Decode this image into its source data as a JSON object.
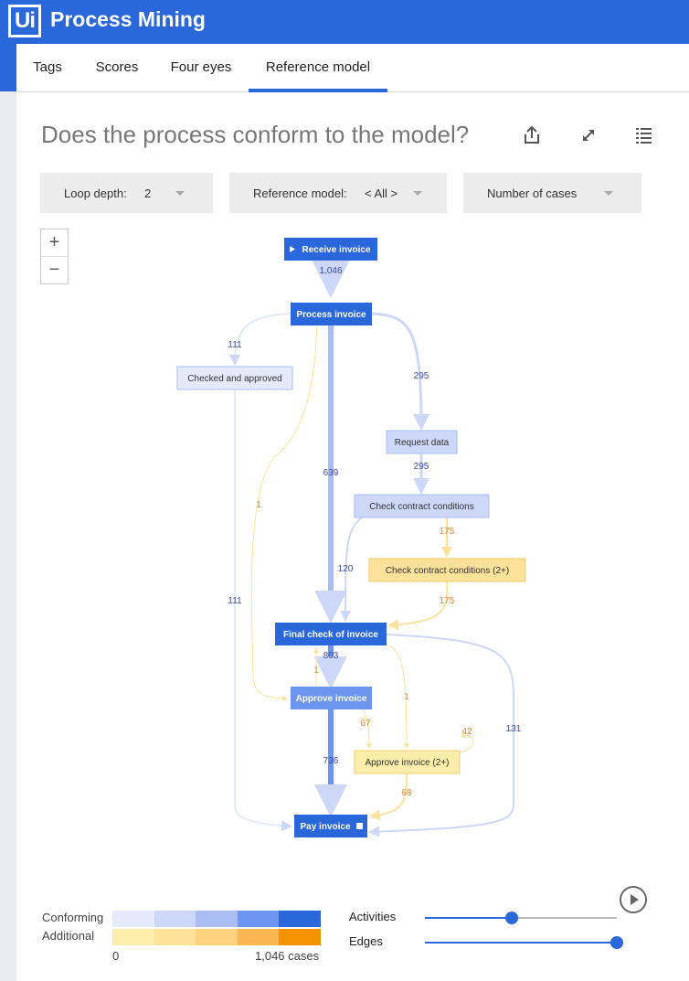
{
  "app": {
    "logo_text": "Ui",
    "title": "Process Mining"
  },
  "tabs": [
    {
      "label": "Tags",
      "active": false
    },
    {
      "label": "Scores",
      "active": false
    },
    {
      "label": "Four eyes",
      "active": false
    },
    {
      "label": "Reference model",
      "active": true
    }
  ],
  "page_title": "Does the process conform to the model?",
  "toolbar_icons": [
    "share-icon",
    "expand-icon",
    "list-icon"
  ],
  "filters": {
    "loop_depth": {
      "label": "Loop depth:",
      "value": "2"
    },
    "reference_model": {
      "label": "Reference model:",
      "value": "< All >"
    },
    "metric": {
      "value": "Number of cases"
    }
  },
  "zoom": {
    "in": "+",
    "out": "−"
  },
  "graph": {
    "nodes": [
      {
        "id": "receive",
        "label": "Receive invoice",
        "kind": "start",
        "fill": "#2a67db",
        "text": "#ffffff"
      },
      {
        "id": "process",
        "label": "Process invoice",
        "kind": "normal",
        "fill": "#2a67db",
        "text": "#ffffff"
      },
      {
        "id": "checked",
        "label": "Checked and approved",
        "kind": "normal",
        "fill": "#e4eafb",
        "text": "#333333"
      },
      {
        "id": "request",
        "label": "Request data",
        "kind": "normal",
        "fill": "#cdd8f8",
        "text": "#333333"
      },
      {
        "id": "ccc",
        "label": "Check contract conditions",
        "kind": "normal",
        "fill": "#cdd8f8",
        "text": "#333333"
      },
      {
        "id": "ccc2",
        "label": "Check contract conditions (2+)",
        "kind": "normal",
        "fill": "#fce29a",
        "text": "#333333"
      },
      {
        "id": "final",
        "label": "Final check of invoice",
        "kind": "normal",
        "fill": "#2a67db",
        "text": "#ffffff"
      },
      {
        "id": "approve",
        "label": "Approve invoice",
        "kind": "normal",
        "fill": "#6b95ee",
        "text": "#ffffff"
      },
      {
        "id": "approve2",
        "label": "Approve invoice (2+)",
        "kind": "normal",
        "fill": "#fcedaa",
        "text": "#333333"
      },
      {
        "id": "pay",
        "label": "Pay invoice",
        "kind": "end",
        "fill": "#2a67db",
        "text": "#ffffff"
      }
    ],
    "edges": [
      {
        "from": "receive",
        "to": "process",
        "value": "1,046",
        "type": "conforming"
      },
      {
        "from": "process",
        "to": "checked",
        "value": "111",
        "type": "conforming"
      },
      {
        "from": "process",
        "to": "request",
        "value": "295",
        "type": "conforming"
      },
      {
        "from": "process",
        "to": "final",
        "value": "639",
        "type": "conforming"
      },
      {
        "from": "process",
        "to": "approve",
        "value": "1",
        "type": "additional"
      },
      {
        "from": "request",
        "to": "ccc",
        "value": "295",
        "type": "conforming"
      },
      {
        "from": "ccc",
        "to": "ccc2",
        "value": "175",
        "type": "additional"
      },
      {
        "from": "ccc",
        "to": "final",
        "value": "120",
        "type": "conforming"
      },
      {
        "from": "ccc2",
        "to": "final",
        "value": "175",
        "type": "additional"
      },
      {
        "from": "checked",
        "to": "pay",
        "value": "111",
        "type": "conforming"
      },
      {
        "from": "final",
        "to": "approve",
        "value": "803",
        "type": "conforming"
      },
      {
        "from": "approve",
        "to": "final",
        "value": "1",
        "type": "additional"
      },
      {
        "from": "final",
        "to": "approve2",
        "value": "1",
        "type": "additional"
      },
      {
        "from": "final",
        "to": "pay",
        "value": "131",
        "type": "conforming"
      },
      {
        "from": "approve",
        "to": "approve2",
        "value": "67",
        "type": "additional"
      },
      {
        "from": "approve2",
        "to": "approve2",
        "value": "42",
        "type": "additional"
      },
      {
        "from": "approve",
        "to": "pay",
        "value": "736",
        "type": "conforming"
      },
      {
        "from": "approve2",
        "to": "pay",
        "value": "68",
        "type": "additional"
      }
    ]
  },
  "legend": {
    "conforming_label": "Conforming",
    "additional_label": "Additional",
    "conforming_colors": [
      "#e4eafb",
      "#cdd8f8",
      "#a9bdf4",
      "#6b95ee",
      "#2a67db"
    ],
    "additional_colors": [
      "#fcedaa",
      "#fce29a",
      "#fcd27f",
      "#f9b651",
      "#f59200"
    ],
    "min_label": "0",
    "max_label": "1,046 cases"
  },
  "sliders": {
    "activities": {
      "label": "Activities",
      "value": 0.45
    },
    "edges": {
      "label": "Edges",
      "value": 1.0
    }
  },
  "colors": {
    "accent": "#2a67db",
    "conforming_edge_text": "#3b4aa8",
    "additional_edge_text": "#e08a2c"
  }
}
